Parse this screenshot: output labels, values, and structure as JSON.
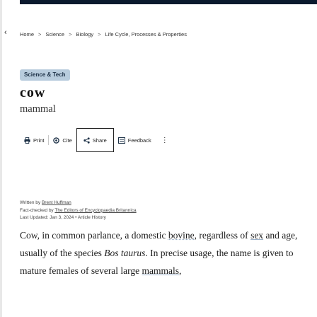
{
  "breadcrumb": [
    "Home",
    "Science",
    "Biology",
    "Life Cycle, Processes & Properties"
  ],
  "breadcrumb_separator": ">",
  "badge": "Science & Tech",
  "title": "cow",
  "subtitle": "mammal",
  "toolbar": {
    "print_label": "Print",
    "cite_label": "Cite",
    "share_label": "Share",
    "feedback_label": "Feedback"
  },
  "byline": {
    "written_prefix": "Written by",
    "author": "Brent Huffman",
    "factcheck_prefix": "Fact-checked by",
    "factchecker": "The Editors of Encyclopaedia Britannica",
    "updated_prefix": "Last Updated:",
    "updated_date": "Jan 3, 2024",
    "dot": "•",
    "history_link": "Article History"
  },
  "article": {
    "p1_a": "Cow, in common parlance, a domestic ",
    "link_bovine": "bovine",
    "p1_b": ", regardless of ",
    "link_sex": "sex",
    "p1_c": " and age, usually of the species ",
    "p1_italic": "Bos taurus",
    "p1_d": ". In precise usage, the name is given to mature females of several large ",
    "link_mammals": "mammals",
    "p1_e": ","
  },
  "colors": {
    "topbar": "#0b1a2e",
    "badge_bg": "#b8ccdd",
    "link_underline": "#9bb0c8"
  }
}
